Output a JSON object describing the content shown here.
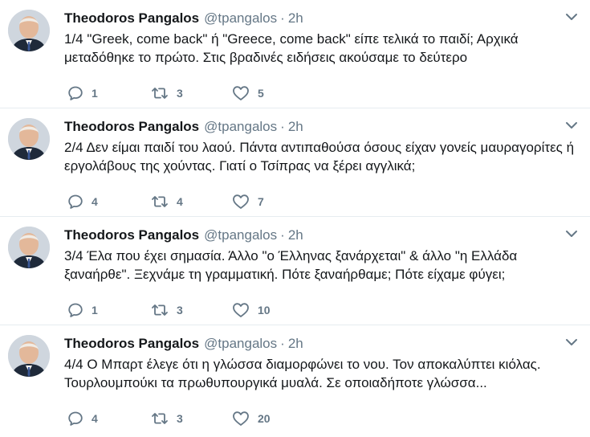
{
  "tweets": [
    {
      "name": "Theodoros Pangalos",
      "handle": "@tpangalos",
      "separator": "·",
      "time": "2h",
      "text": "1/4 \"Greek, come back\" ή \"Greece, come back\" είπε τελικά το παιδί; Αρχικά μεταδόθηκε το πρώτο. Στις βραδινές ειδήσεις ακούσαμε το δεύτερο",
      "replies": "1",
      "retweets": "3",
      "likes": "5"
    },
    {
      "name": "Theodoros Pangalos",
      "handle": "@tpangalos",
      "separator": "·",
      "time": "2h",
      "text": "2/4 Δεν είμαι παιδί του λαού. Πάντα αντιπαθούσα όσους είχαν γονείς μαυραγορίτες ή εργολάβους της χούντας. Γιατί ο Τσίπρας να ξέρει αγγλικά;",
      "replies": "4",
      "retweets": "4",
      "likes": "7"
    },
    {
      "name": "Theodoros Pangalos",
      "handle": "@tpangalos",
      "separator": "·",
      "time": "2h",
      "text": "3/4 Έλα που έχει σημασία. Άλλο \"ο Έλληνας ξανάρχεται\" & άλλο \"η Ελλάδα ξαναήρθε\". Ξεχνάμε τη γραμματική. Πότε ξαναήρθαμε; Πότε είχαμε φύγει;",
      "replies": "1",
      "retweets": "3",
      "likes": "10"
    },
    {
      "name": "Theodoros Pangalos",
      "handle": "@tpangalos",
      "separator": "·",
      "time": "2h",
      "text": "4/4 Ο Μπαρτ έλεγε ότι η γλώσσα διαμορφώνει το νου. Τον αποκαλύπτει κιόλας. Τουρλουμπούκι τα πρωθυπουργικά μυαλά. Σε οποιαδήποτε γλώσσα...",
      "replies": "4",
      "retweets": "3",
      "likes": "20"
    }
  ],
  "icons": {
    "reply": "reply-icon",
    "retweet": "retweet-icon",
    "like": "heart-icon",
    "menu": "chevron-down-icon"
  },
  "colors": {
    "text": "#14171a",
    "muted": "#657786",
    "divider": "#e6ecf0"
  }
}
